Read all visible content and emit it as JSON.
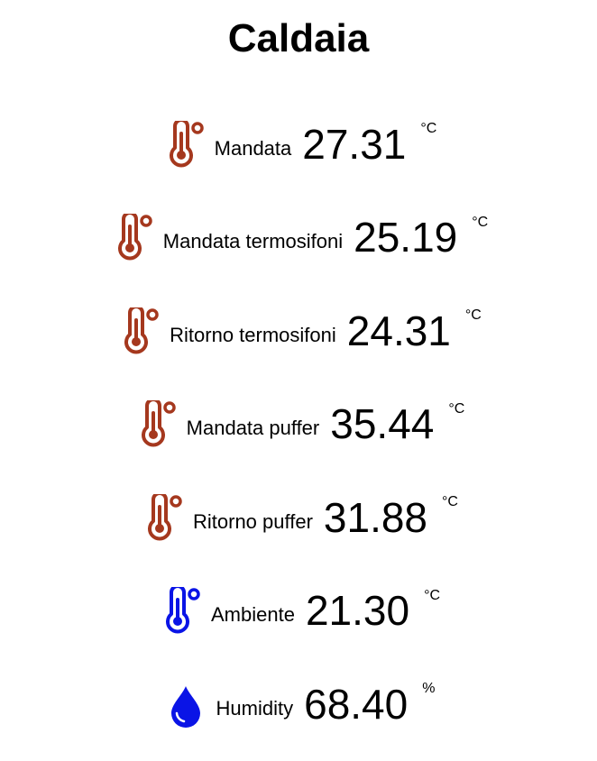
{
  "page": {
    "title": "Caldaia"
  },
  "colors": {
    "thermometer_hot": "#a5381e",
    "thermometer_cold": "#0a14e6",
    "humidity": "#0a14e6"
  },
  "sensors": [
    {
      "label": "Mandata",
      "value": "27.31",
      "unit": "°C",
      "icon": "thermometer-icon"
    },
    {
      "label": "Mandata termosifoni",
      "value": "25.19",
      "unit": "°C",
      "icon": "thermometer-icon"
    },
    {
      "label": "Ritorno termosifoni",
      "value": "24.31",
      "unit": "°C",
      "icon": "thermometer-icon"
    },
    {
      "label": "Mandata puffer",
      "value": "35.44",
      "unit": "°C",
      "icon": "thermometer-icon"
    },
    {
      "label": "Ritorno puffer",
      "value": "31.88",
      "unit": "°C",
      "icon": "thermometer-icon"
    },
    {
      "label": "Ambiente",
      "value": "21.30",
      "unit": "°C",
      "icon": "thermometer-icon"
    },
    {
      "label": "Humidity",
      "value": "68.40",
      "unit": "%",
      "icon": "water-drop-icon"
    }
  ]
}
